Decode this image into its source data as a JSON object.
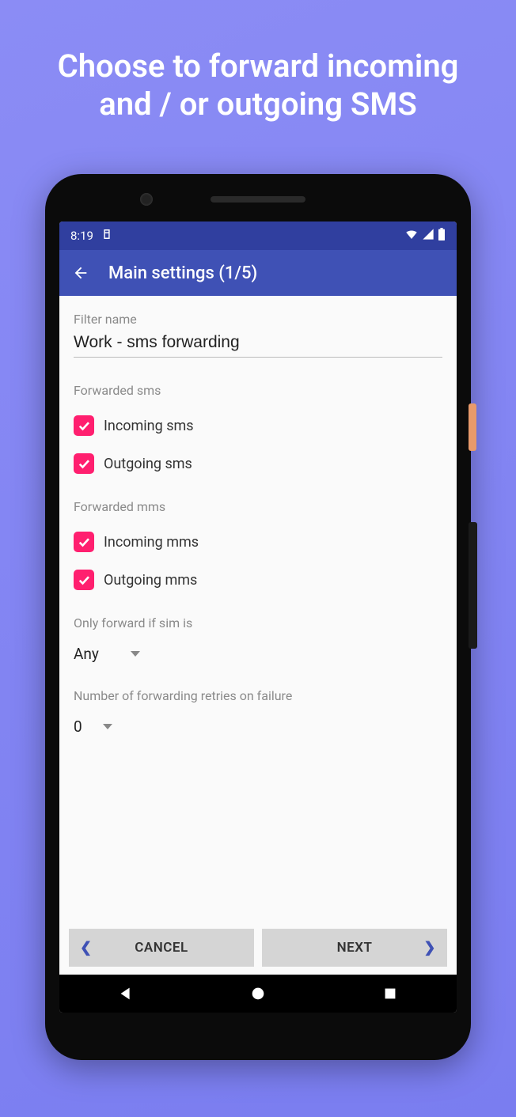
{
  "promo": {
    "headline_line1": "Choose to forward incoming",
    "headline_line2": "and / or outgoing SMS"
  },
  "status_bar": {
    "time": "8:19"
  },
  "app_bar": {
    "title": "Main settings (1/5)"
  },
  "filter_name": {
    "label": "Filter name",
    "value": "Work - sms forwarding"
  },
  "forwarded_sms": {
    "section_label": "Forwarded sms",
    "items": [
      {
        "label": "Incoming sms",
        "checked": true
      },
      {
        "label": "Outgoing sms",
        "checked": true
      }
    ]
  },
  "forwarded_mms": {
    "section_label": "Forwarded mms",
    "items": [
      {
        "label": "Incoming mms",
        "checked": true
      },
      {
        "label": "Outgoing mms",
        "checked": true
      }
    ]
  },
  "sim_filter": {
    "label": "Only forward if sim is",
    "value": "Any"
  },
  "retries": {
    "label": "Number of forwarding retries on failure",
    "value": "0"
  },
  "buttons": {
    "cancel": "CANCEL",
    "next": "NEXT"
  }
}
